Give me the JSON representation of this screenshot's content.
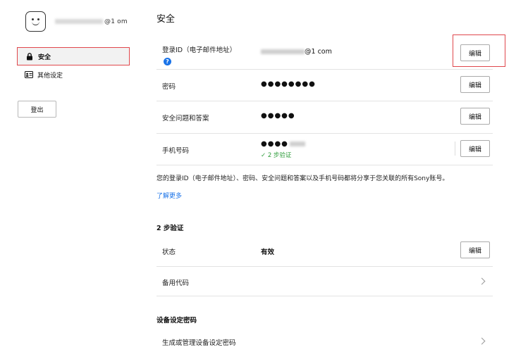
{
  "sidebar": {
    "email_visible_suffix": "@1 om",
    "nav": [
      {
        "label": "安全",
        "icon": "lock-icon"
      },
      {
        "label": "其他设定",
        "icon": "id-card-icon"
      }
    ],
    "logout_label": "登出"
  },
  "main": {
    "title": "安全",
    "rows": [
      {
        "label": "登录ID（电子邮件地址）",
        "value_suffix": "@1 com",
        "button": "编辑"
      },
      {
        "label": "密码",
        "value": "●●●●●●●●",
        "button": "编辑"
      },
      {
        "label": "安全问题和答案",
        "value": "●●●●●",
        "button": "编辑"
      },
      {
        "label": "手机号码",
        "value_prefix": "●●●●",
        "verified": "✓ 2 步验证",
        "button": "编辑"
      }
    ],
    "notice": "您的登录ID（电子邮件地址）、密码、安全问题和答案以及手机号码都将分享于您关联的所有Sony账号。",
    "learn_more": "了解更多"
  },
  "two_step": {
    "title": "2 步验证",
    "status_label": "状态",
    "status_value": "有效",
    "button": "编辑",
    "backup_codes": "备用代码"
  },
  "device_password": {
    "title": "设备设定密码",
    "manage": "生成或管理设备设定密码"
  },
  "colors": {
    "highlight": "#e0474c",
    "link": "#1a73e8",
    "verified": "#2e9d3b"
  }
}
